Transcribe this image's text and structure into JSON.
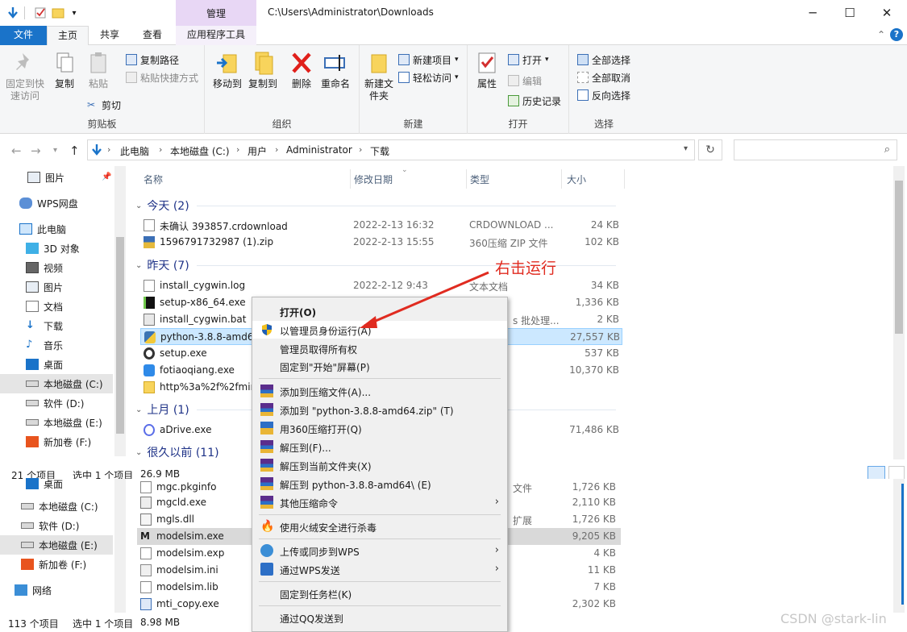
{
  "window": {
    "title_path": "C:\\Users\\Administrator\\Downloads",
    "manage_tab": "管理",
    "help": "?"
  },
  "tabs": {
    "file": "文件",
    "home": "主页",
    "share": "共享",
    "view": "查看",
    "app_tools": "应用程序工具"
  },
  "ribbon": {
    "clipboard": {
      "label": "剪贴板",
      "pin_quick": "固定到快速访问",
      "copy": "复制",
      "paste": "粘贴",
      "copy_path": "复制路径",
      "paste_shortcut": "粘贴快捷方式",
      "cut": "剪切"
    },
    "organize": {
      "label": "组织",
      "move_to": "移动到",
      "copy_to": "复制到",
      "delete": "删除",
      "rename": "重命名"
    },
    "new": {
      "label": "新建",
      "new_folder": "新建文件夹",
      "new_item": "新建项目",
      "easy_access": "轻松访问"
    },
    "open": {
      "label": "打开",
      "properties": "属性",
      "open": "打开",
      "edit": "编辑",
      "history": "历史记录"
    },
    "select": {
      "label": "选择",
      "select_all": "全部选择",
      "select_none": "全部取消",
      "invert": "反向选择"
    }
  },
  "address": {
    "crumbs": [
      "此电脑",
      "本地磁盘 (C:)",
      "用户",
      "Administrator",
      "下载"
    ]
  },
  "nav": {
    "items": [
      "图片",
      "WPS网盘",
      "此电脑",
      "3D 对象",
      "视频",
      "图片",
      "文档",
      "下载",
      "音乐",
      "桌面",
      "本地磁盘 (C:)",
      "软件 (D:)",
      "本地磁盘 (E:)",
      "新加卷 (F:)"
    ]
  },
  "columns": {
    "name": "名称",
    "date": "修改日期",
    "type": "类型",
    "size": "大小"
  },
  "groups": {
    "today": "今天 (2)",
    "yesterday": "昨天 (7)",
    "last_month": "上月 (1)",
    "long_ago": "很久以前 (11)"
  },
  "files": {
    "today": [
      {
        "name": "未确认 393857.crdownload",
        "date": "2022-2-13 16:32",
        "type": "CRDOWNLOAD ...",
        "size": "24 KB"
      },
      {
        "name": "1596791732987 (1).zip",
        "date": "2022-2-13 15:55",
        "type": "360压缩 ZIP 文件",
        "size": "102 KB"
      }
    ],
    "yesterday": [
      {
        "name": "install_cygwin.log",
        "date": "2022-2-12 9:43",
        "type": "文本文档",
        "size": "34 KB"
      },
      {
        "name": "setup-x86_64.exe",
        "date": "",
        "type": "",
        "size": "1,336 KB"
      },
      {
        "name": "install_cygwin.bat",
        "date": "",
        "type": "s 批处理...",
        "size": "2 KB"
      },
      {
        "name": "python-3.8.8-amd64",
        "date": "",
        "type": "",
        "size": "27,557 KB"
      },
      {
        "name": "setup.exe",
        "date": "",
        "type": "",
        "size": "537 KB"
      },
      {
        "name": "fotiaoqiang.exe",
        "date": "",
        "type": "",
        "size": "10,370 KB"
      },
      {
        "name": "http%3a%2f%2fmiru",
        "date": "",
        "type": "",
        "size": ""
      }
    ],
    "last_month": [
      {
        "name": "aDrive.exe",
        "date": "",
        "type": "",
        "size": "71,486 KB"
      }
    ]
  },
  "status_top": {
    "count": "21 个项目",
    "selected": "选中 1 个项目",
    "size": "26.9 MB"
  },
  "second_window": {
    "nav": [
      "桌面",
      "本地磁盘 (C:)",
      "软件 (D:)",
      "本地磁盘 (E:)",
      "新加卷 (F:)",
      "网络"
    ],
    "files": [
      {
        "name": "mgc.pkginfo",
        "type": "文件",
        "size": "1,726 KB"
      },
      {
        "name": "mgcld.exe",
        "type": "",
        "size": "2,110 KB"
      },
      {
        "name": "mgls.dll",
        "type": "扩展",
        "size": "1,726 KB"
      },
      {
        "name": "modelsim.exe",
        "type": "",
        "size": "9,205 KB"
      },
      {
        "name": "modelsim.exp",
        "type": "",
        "size": "4 KB"
      },
      {
        "name": "modelsim.ini",
        "type": "",
        "size": "11 KB"
      },
      {
        "name": "modelsim.lib",
        "type": "",
        "size": "7 KB"
      },
      {
        "name": "mti_copy.exe",
        "type": "",
        "size": "2,302 KB"
      }
    ],
    "status": {
      "count": "113 个项目",
      "selected": "选中 1 个项目",
      "size": "8.98 MB"
    }
  },
  "context_menu": {
    "open": "打开(O)",
    "run_as_admin": "以管理员身份运行(A)",
    "take_ownership": "管理员取得所有权",
    "pin_start": "固定到\"开始\"屏幕(P)",
    "add_archive": "添加到压缩文件(A)...",
    "add_zip": "添加到 \"python-3.8.8-amd64.zip\" (T)",
    "open_360": "用360压缩打开(Q)",
    "extract_to": "解压到(F)...",
    "extract_here": "解压到当前文件夹(X)",
    "extract_folder": "解压到 python-3.8.8-amd64\\ (E)",
    "other_compress": "其他压缩命令",
    "huorong": "使用火绒安全进行杀毒",
    "upload_wps": "上传或同步到WPS",
    "send_wps": "通过WPS发送",
    "pin_taskbar": "固定到任务栏(K)",
    "send_qq": "通过QQ发送到"
  },
  "annotation": {
    "callout": "右击运行"
  },
  "watermark": "CSDN @stark-lin",
  "colors": {
    "accent": "#1a73c9",
    "manage": "#e8d7f5",
    "selection": "#cce8ff",
    "callout": "#e02b20"
  }
}
